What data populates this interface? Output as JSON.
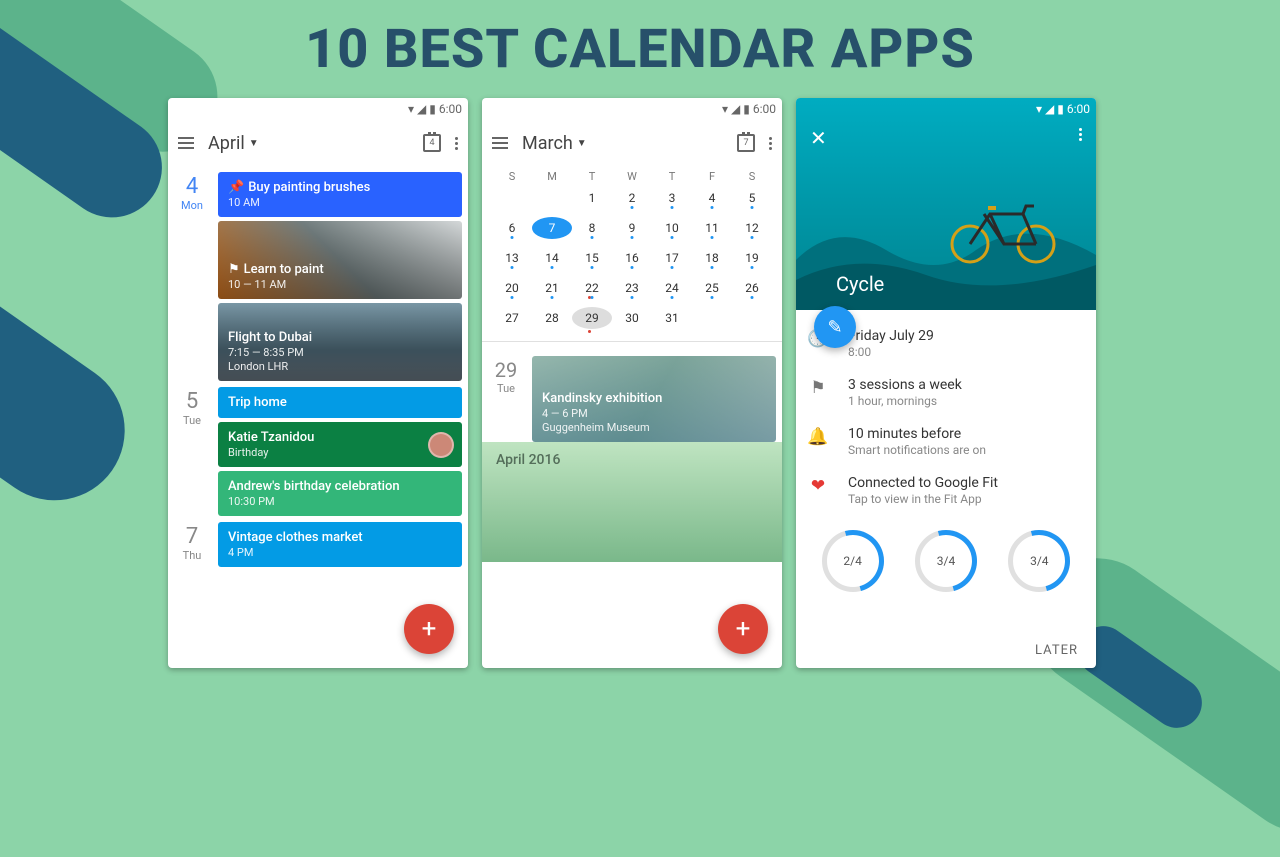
{
  "title": "10 BEST CALENDAR APPS",
  "status_time": "6:00",
  "phone1": {
    "month": "April",
    "today_badge": "4",
    "days": [
      {
        "num": "4",
        "dow": "Mon",
        "hl": true,
        "events": [
          {
            "title": "Buy painting brushes",
            "sub": "10 AM",
            "bg": "#2962ff",
            "icon": "pin"
          },
          {
            "title": "Learn to paint",
            "sub": "10 — 11 AM",
            "img": "paint",
            "icon": "flag"
          },
          {
            "title": "Flight to Dubai",
            "sub": "7:15 — 8:35 PM",
            "sub2": "London LHR",
            "img": "city"
          }
        ]
      },
      {
        "num": "5",
        "dow": "Tue",
        "events": [
          {
            "title": "Trip home",
            "bg": "#039be5"
          },
          {
            "title": "Katie Tzanidou",
            "sub": "Birthday",
            "bg": "#0b8043",
            "avatar": true
          },
          {
            "title": "Andrew's birthday celebration",
            "sub": "10:30 PM",
            "bg": "#33b679"
          }
        ]
      },
      {
        "num": "7",
        "dow": "Thu",
        "events": [
          {
            "title": "Vintage clothes market",
            "sub": "4 PM",
            "bg": "#039be5"
          }
        ]
      }
    ]
  },
  "phone2": {
    "month": "March",
    "today_badge": "7",
    "dow": [
      "S",
      "M",
      "T",
      "W",
      "T",
      "F",
      "S"
    ],
    "weeks": [
      [
        "",
        "",
        "1",
        "2",
        "3",
        "4",
        "5"
      ],
      [
        "6",
        "7",
        "8",
        "9",
        "10",
        "11",
        "12"
      ],
      [
        "13",
        "14",
        "15",
        "16",
        "17",
        "18",
        "19"
      ],
      [
        "20",
        "21",
        "22",
        "23",
        "24",
        "25",
        "26"
      ],
      [
        "27",
        "28",
        "29",
        "30",
        "31",
        "",
        ""
      ]
    ],
    "selected": "7",
    "today": "29",
    "event_day": {
      "num": "29",
      "dow": "Tue"
    },
    "event": {
      "title": "Kandinsky exhibition",
      "sub": "4 — 6 PM",
      "sub2": "Guggenheim Museum"
    },
    "header_label": "April 2016"
  },
  "phone3": {
    "title": "Cycle",
    "rows": [
      {
        "icon": "clock",
        "t1": "Friday July 29",
        "t2": "8:00"
      },
      {
        "icon": "flag",
        "t1": "3 sessions a week",
        "t2": "1 hour, mornings"
      },
      {
        "icon": "bell",
        "t1": "10 minutes before",
        "t2": "Smart notifications are on"
      },
      {
        "icon": "heart",
        "t1": "Connected to Google Fit",
        "t2": "Tap to view in the Fit App"
      }
    ],
    "rings": [
      "2/4",
      "3/4",
      "3/4"
    ],
    "later": "LATER"
  }
}
